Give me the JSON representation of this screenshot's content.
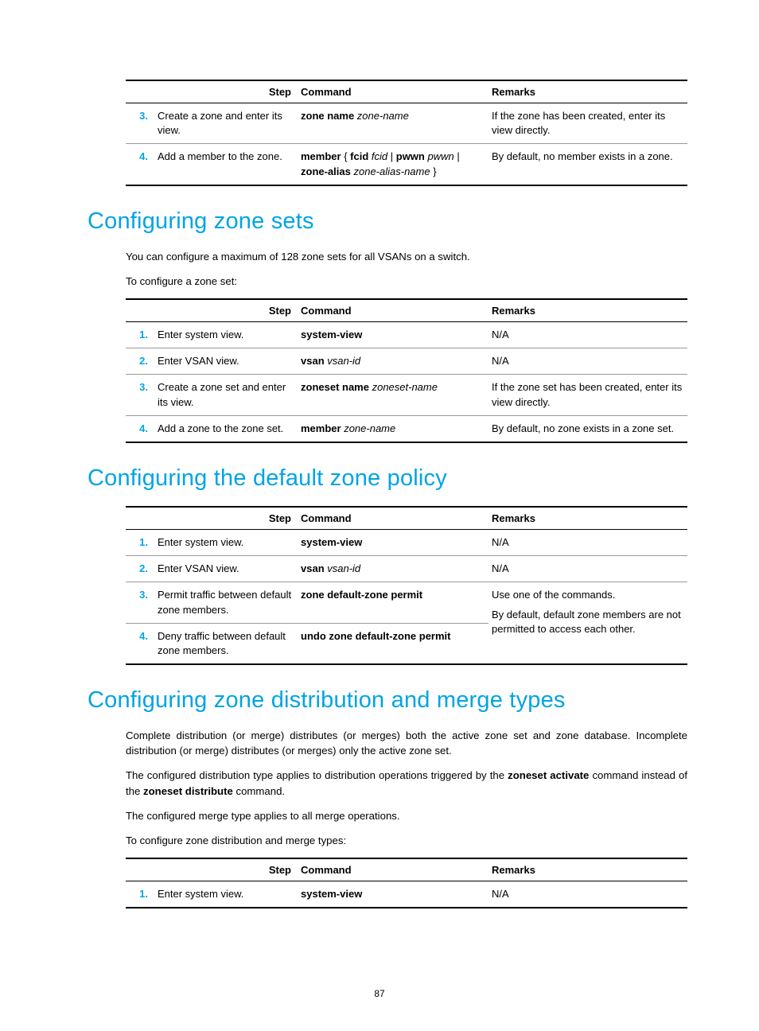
{
  "table1": {
    "headers": {
      "step": "Step",
      "command": "Command",
      "remarks": "Remarks"
    },
    "rows": [
      {
        "num": "3.",
        "step": "Create a zone and enter its view.",
        "cmd_parts": [
          {
            "t": "zone name ",
            "b": true
          },
          {
            "t": "zone-name",
            "i": true
          }
        ],
        "remarks": "If the zone has been created, enter its view directly."
      },
      {
        "num": "4.",
        "step": "Add a member to the zone.",
        "cmd_parts": [
          {
            "t": "member",
            "b": true
          },
          {
            "t": " { "
          },
          {
            "t": "fcid",
            "b": true
          },
          {
            "t": " "
          },
          {
            "t": "fcid",
            "i": true
          },
          {
            "t": " | "
          },
          {
            "t": "pwwn",
            "b": true
          },
          {
            "t": " "
          },
          {
            "t": "pwwn",
            "i": true
          },
          {
            "t": " | "
          },
          {
            "t": "zone-alias",
            "b": true
          },
          {
            "t": " "
          },
          {
            "t": "zone-alias-name",
            "i": true
          },
          {
            "t": " }"
          }
        ],
        "remarks": "By default, no member exists in a zone."
      }
    ]
  },
  "section1_title": "Configuring zone sets",
  "section1_p1": "You can configure a maximum of 128 zone sets for all VSANs on a switch.",
  "section1_p2": "To configure a zone set:",
  "table2": {
    "headers": {
      "step": "Step",
      "command": "Command",
      "remarks": "Remarks"
    },
    "rows": [
      {
        "num": "1.",
        "step": "Enter system view.",
        "cmd_parts": [
          {
            "t": "system-view",
            "b": true
          }
        ],
        "remarks": "N/A"
      },
      {
        "num": "2.",
        "step": "Enter VSAN view.",
        "cmd_parts": [
          {
            "t": "vsan ",
            "b": true
          },
          {
            "t": "vsan-id",
            "i": true
          }
        ],
        "remarks": "N/A"
      },
      {
        "num": "3.",
        "step": "Create a zone set and enter its view.",
        "cmd_parts": [
          {
            "t": "zoneset name ",
            "b": true
          },
          {
            "t": "zoneset-name",
            "i": true
          }
        ],
        "remarks": "If the zone set has been created, enter its view directly."
      },
      {
        "num": "4.",
        "step": "Add a zone to the zone set.",
        "cmd_parts": [
          {
            "t": "member ",
            "b": true
          },
          {
            "t": "zone-name",
            "i": true
          }
        ],
        "remarks": "By default, no zone exists in a zone set."
      }
    ]
  },
  "section2_title": "Configuring the default zone policy",
  "table3": {
    "headers": {
      "step": "Step",
      "command": "Command",
      "remarks": "Remarks"
    },
    "rows": [
      {
        "num": "1.",
        "step": "Enter system view.",
        "cmd_parts": [
          {
            "t": "system-view",
            "b": true
          }
        ],
        "remarks": "N/A"
      },
      {
        "num": "2.",
        "step": "Enter VSAN view.",
        "cmd_parts": [
          {
            "t": "vsan ",
            "b": true
          },
          {
            "t": "vsan-id",
            "i": true
          }
        ],
        "remarks": "N/A"
      },
      {
        "num": "3.",
        "step": "Permit traffic between default zone members.",
        "cmd_parts": [
          {
            "t": "zone default-zone permit",
            "b": true
          }
        ],
        "remarks": "Use one of the commands.",
        "merged_first": true
      },
      {
        "num": "4.",
        "step": "Deny traffic between default zone members.",
        "cmd_parts": [
          {
            "t": "undo zone default-zone permit",
            "b": true
          }
        ],
        "remarks": "By default, default zone members are not permitted to access each other.",
        "merged_last": true
      }
    ]
  },
  "section3_title": "Configuring zone distribution and merge types",
  "section3_p1": "Complete distribution (or merge) distributes (or merges) both the active zone set and zone database. Incomplete distribution (or merge) distributes (or merges) only the active zone set.",
  "section3_p2_parts": [
    {
      "t": "The configured distribution type applies to distribution operations triggered by the "
    },
    {
      "t": "zoneset activate",
      "b": true
    },
    {
      "t": " command instead of the "
    },
    {
      "t": "zoneset distribute",
      "b": true
    },
    {
      "t": " command."
    }
  ],
  "section3_p3": "The configured merge type applies to all merge operations.",
  "section3_p4": "To configure zone distribution and merge types:",
  "table4": {
    "headers": {
      "step": "Step",
      "command": "Command",
      "remarks": "Remarks"
    },
    "rows": [
      {
        "num": "1.",
        "step": "Enter system view.",
        "cmd_parts": [
          {
            "t": "system-view",
            "b": true
          }
        ],
        "remarks": "N/A"
      }
    ]
  },
  "page_number": "87"
}
